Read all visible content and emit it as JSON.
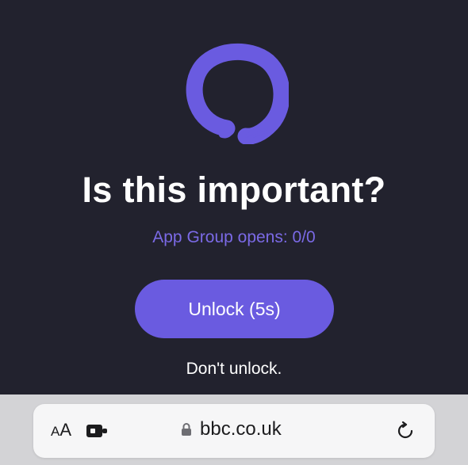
{
  "screen": {
    "title": "Is this important?",
    "subtitle": "App Group opens: 0/0",
    "unlock_label": "Unlock (5s)",
    "dont_unlock_label": "Don't unlock."
  },
  "browser": {
    "aa_small": "A",
    "aa_large": "A",
    "url": "bbc.co.uk",
    "icons": [
      "text-size-icon",
      "extension-icon",
      "lock-icon",
      "reload-icon"
    ]
  },
  "colors": {
    "background": "#22222e",
    "accent": "#6a5be0",
    "subtitle": "#7b6ae6",
    "bar": "#d3d3d6"
  }
}
